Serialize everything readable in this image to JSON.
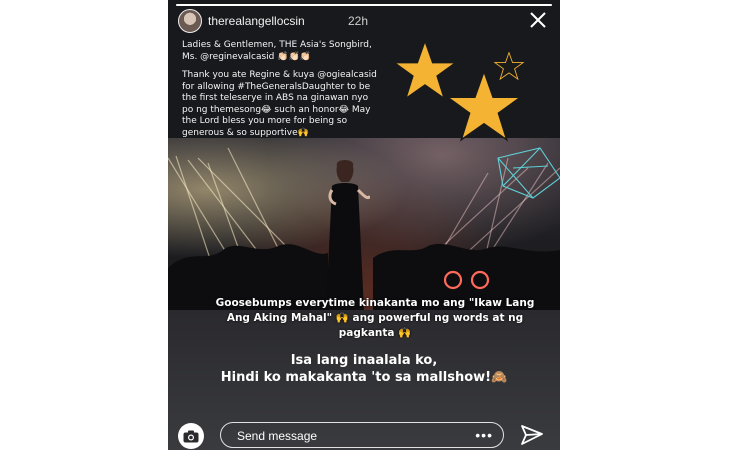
{
  "story": {
    "progress": 1.0,
    "username": "therealangellocsin",
    "time_ago": "22h"
  },
  "caption": {
    "paragraph1": "Ladies & Gentlemen, THE Asia's Songbird, Ms. @reginevalcasid 👏🏻👏🏻👏🏻",
    "paragraph2": "Thank you ate Regine & kuya @ogiealcasid  for allowing #TheGeneralsDaughter  to be the first teleserye in ABS na ginawan nyo po ng themesong😂 such an honor😂 May the Lord bless you more for being so generous & so supportive🙌"
  },
  "overlay": {
    "text1": "Goosebumps everytime kinakanta mo ang \"Ikaw Lang Ang Aking Mahal\" 🙌 ang powerful ng words at ng pagkanta 🙌",
    "text2_line1": "Isa lang inaalala ko,",
    "text2_line2": "Hindi ko makakanta 'to sa mallshow!🙈"
  },
  "footer": {
    "message_placeholder": "Send message",
    "more": "•••"
  },
  "icons": {
    "close": "close-icon",
    "camera": "camera-icon",
    "send": "send-icon",
    "star": "star-icon"
  },
  "colors": {
    "star_yellow": "#f5b334",
    "star_dark": "#1a1a1a"
  }
}
